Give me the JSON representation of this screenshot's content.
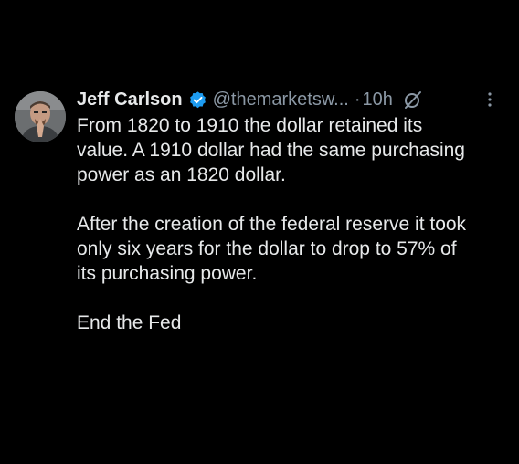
{
  "tweet": {
    "author": {
      "name": "Jeff Carlson",
      "handle": "@themarketsw...",
      "verified_icon": "verified-badge-icon",
      "verified_color": "#1d9bf0"
    },
    "separator": "·",
    "time": "10h",
    "grok_icon": "grok-slash-icon",
    "more_icon": "more-vertical-icon",
    "text": {
      "p1_l1": "From 1820 to 1910 the dollar retained its",
      "p1_l2": "value. A 1910 dollar had the same purchasing",
      "p1_l3": "power as an 1820 dollar.",
      "p2_l1": "After the creation of the federal reserve it took",
      "p2_l2": "only six years for the dollar to drop to 57% of",
      "p2_l3": "its purchasing power.",
      "p3_l1": "End the Fed"
    }
  },
  "colors": {
    "background": "#000000",
    "text_primary": "#e7e9ea",
    "text_secondary": "#8b98a5"
  }
}
